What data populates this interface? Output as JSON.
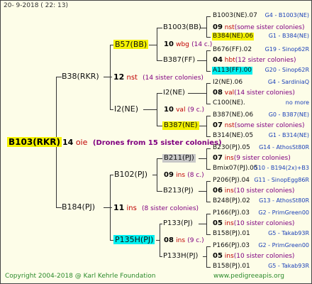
{
  "header": {
    "date": "20-  9-2018 ( 22: 13)"
  },
  "footer": {
    "copyright": "Copyright 2004-2018 @ Karl Kehrle Foundation",
    "website": "www.pedigreeapis.org"
  },
  "colors": {
    "background": "#fdfde8",
    "yellow": "#f4f200",
    "cyan": "#00f0f0",
    "gray": "#c8c8c8",
    "red": "#c00000",
    "blue": "#1a3fb8",
    "purple": "#800080"
  },
  "root": {
    "id": "B103(RKR)",
    "num": "14",
    "sfx": "oie",
    "note": "(Drones from 15 sister colonies)"
  },
  "g1": [
    {
      "id": "B38(RKR)",
      "num": "12",
      "sfx": "nst",
      "note": "(14 sister colonies)"
    },
    {
      "id": "B184(PJ)",
      "num": "11",
      "sfx": "ins",
      "note": "(8 sister colonies)"
    }
  ],
  "g2": [
    {
      "id": "B57(BB)",
      "num": "10",
      "sfx": "wbg",
      "note": "(14 c.)"
    },
    {
      "id": "I2(NE)",
      "num": "10",
      "sfx": "val",
      "note": "(9 c.)"
    },
    {
      "id": "B102(PJ)",
      "num": "09",
      "sfx": "ins",
      "note": "(8 c.)"
    },
    {
      "id": "P135H(PJ)",
      "num": "08",
      "sfx": "ins",
      "note": "(9 c.)"
    }
  ],
  "g3": [
    {
      "id": "B1003(BB)",
      "num": "09",
      "sfx": "nst",
      "note": "(some sister colonies)"
    },
    {
      "id": "B387(FF)",
      "num": "04",
      "sfx": "hbt",
      "note": "(12 sister colonies)"
    },
    {
      "id": "I2(NE)",
      "num": "08",
      "sfx": "val",
      "note": "(14 sister colonies)"
    },
    {
      "id": "B387(NE)",
      "num": "07",
      "sfx": "nst",
      "note": "(some sister colonies)"
    },
    {
      "id": "B211(PJ)",
      "num": "07",
      "sfx": "ins",
      "note": "(9 sister colonies)"
    },
    {
      "id": "B213(PJ)",
      "num": "06",
      "sfx": "ins",
      "note": "(10 sister colonies)"
    },
    {
      "id": "P133(PJ)",
      "num": "05",
      "sfx": "ins",
      "note": "(10 sister colonies)"
    },
    {
      "id": "P133H(PJ)",
      "num": "05",
      "sfx": "ins",
      "note": "(10 sister colonies)"
    }
  ],
  "g4": [
    {
      "id": "B1003(NE).07",
      "ref": "G4 - B1003(NE)"
    },
    {
      "id": "B384(NE).06",
      "ref": "G1 - B384(NE)"
    },
    {
      "id": "B676(FF).02",
      "ref": "G19 - Sinop62R"
    },
    {
      "id": "A113(FF).00",
      "ref": "G20 - Sinop62R"
    },
    {
      "id": "I2(NE).06",
      "ref": "G4 - SardiniaQ"
    },
    {
      "id": "C100(NE).",
      "ref": "no more"
    },
    {
      "id": "B387(NE).06",
      "ref": "G0 - B387(NE)"
    },
    {
      "id": "B314(NE).05",
      "ref": "G1 - B314(NE)"
    },
    {
      "id": "B230(PJ).05",
      "ref": "G14 - AthosSt80R"
    },
    {
      "id": "Bmix07(PJ).05",
      "ref": "G10 - B194(2x)+B3"
    },
    {
      "id": "P206(PJ).04",
      "ref": "G11 - SinopEgg86R"
    },
    {
      "id": "B248(PJ).02",
      "ref": "G13 - AthosSt80R"
    },
    {
      "id": "P166(PJ).03",
      "ref": "G2 - PrimGreen00"
    },
    {
      "id": "B158(PJ).01",
      "ref": "G5 - Takab93R"
    },
    {
      "id": "P166(PJ).03",
      "ref": "G2 - PrimGreen00"
    },
    {
      "id": "B158(PJ).01",
      "ref": "G5 - Takab93R"
    }
  ]
}
